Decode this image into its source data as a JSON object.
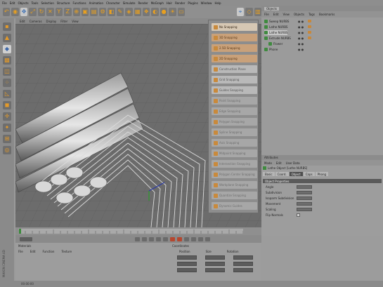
{
  "menubar": {
    "items": [
      "File",
      "Edit",
      "Objects",
      "Tools",
      "Selection",
      "Structure",
      "Functions",
      "Animation",
      "Character",
      "Simulate",
      "Render",
      "MoGraph",
      "Hair",
      "Render",
      "Plugins",
      "Window",
      "Help"
    ]
  },
  "viewport": {
    "menu": [
      "Edit",
      "Cameras",
      "Display",
      "Filter",
      "View"
    ]
  },
  "snap_menu": {
    "items": [
      {
        "label": "No Snapping",
        "style": "hl"
      },
      {
        "label": "3D Snapping",
        "style": "orange"
      },
      {
        "label": "2.5D Snapping",
        "style": "orange"
      },
      {
        "label": "2D Snapping",
        "style": "orange"
      },
      {
        "label": "Construction Plane",
        "style": "light"
      },
      {
        "label": "Grid Snapping",
        "style": "light"
      },
      {
        "label": "Guides Snapping",
        "style": "light"
      },
      {
        "label": "Point Snapping",
        "style": "dim"
      },
      {
        "label": "Edge Snapping",
        "style": "dim"
      },
      {
        "label": "Polygon Snapping",
        "style": "dim"
      },
      {
        "label": "Spline Snapping",
        "style": "dim"
      },
      {
        "label": "Axis Snapping",
        "style": "dim"
      },
      {
        "label": "Midpoint Snapping",
        "style": "dim"
      },
      {
        "label": "Intersection Snapping",
        "style": "dim"
      },
      {
        "label": "Polygon Center Snapping",
        "style": "dim"
      },
      {
        "label": "Workplane Snapping",
        "style": "dim"
      },
      {
        "label": "Quantize Snapping",
        "style": "dim"
      },
      {
        "label": "Dynamic Guides",
        "style": "dim"
      }
    ]
  },
  "object_manager": {
    "tab": "Objects",
    "menu": [
      "File",
      "Edit",
      "View",
      "Objects",
      "Tags",
      "Bookmarks"
    ],
    "rows": [
      {
        "label": "Sweep NURBS",
        "selected": false,
        "indent": 0
      },
      {
        "label": "Lathe NURBS",
        "selected": false,
        "indent": 0
      },
      {
        "label": "Lathe NURBS",
        "selected": true,
        "indent": 0
      },
      {
        "label": "Extrude NURBS",
        "selected": false,
        "indent": 0
      },
      {
        "label": "Flower",
        "selected": false,
        "indent": 1
      },
      {
        "label": "Phone",
        "selected": false,
        "indent": 0
      }
    ]
  },
  "attributes": {
    "title": "Attributes",
    "menu": [
      "Mode",
      "Edit",
      "User Data"
    ],
    "object_title": "Lathe Object [Lathe NURBS]",
    "tabs": [
      {
        "label": "Basic",
        "active": false
      },
      {
        "label": "Coord.",
        "active": false
      },
      {
        "label": "Object",
        "active": true
      },
      {
        "label": "Caps",
        "active": false
      },
      {
        "label": "Phong",
        "active": false
      }
    ],
    "section": "Object Properties",
    "params": [
      {
        "label": "Angle",
        "type": "field"
      },
      {
        "label": "Subdivision",
        "type": "field"
      },
      {
        "label": "Isoparm Subdivision",
        "type": "field"
      },
      {
        "label": "Movement",
        "type": "field"
      },
      {
        "label": "Scaling",
        "type": "field"
      },
      {
        "label": "Flip Normals",
        "type": "check"
      }
    ]
  },
  "material_manager": {
    "title": "Materials",
    "menu": [
      "File",
      "Edit",
      "Function",
      "Texture"
    ]
  },
  "coordinates": {
    "title": "Coordinates",
    "columns": [
      "Position",
      "Size",
      "Rotation"
    ]
  },
  "status": {
    "time": "00:00:00"
  },
  "side_label": "MAXON CINEMA 4D",
  "colors": {
    "accent_orange": "#c9a17a",
    "highlight": "#d6c7b3",
    "object_icon_green": "#3f8a3f"
  }
}
